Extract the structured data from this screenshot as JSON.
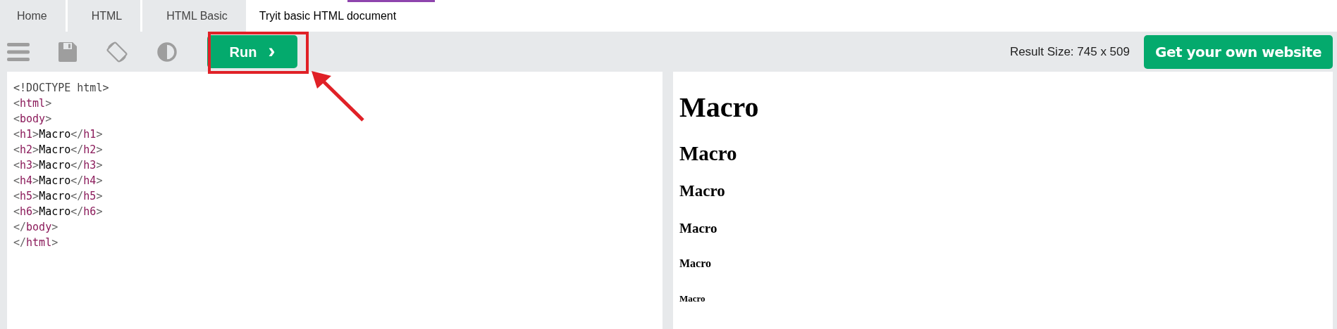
{
  "breadcrumbs": [
    {
      "label": "Home",
      "current": false
    },
    {
      "label": "HTML",
      "current": false
    },
    {
      "label": "HTML Basic",
      "current": false
    },
    {
      "label": "Tryit basic HTML document",
      "current": true
    }
  ],
  "toolbar": {
    "icons": [
      {
        "kind": "menu"
      },
      {
        "kind": "save"
      },
      {
        "kind": "rotate"
      },
      {
        "kind": "contrast"
      }
    ],
    "run_button": {
      "label": "Run",
      "icon": "›"
    },
    "result_size": "Result Size: 745 x 509",
    "cta_button": "Get your own website"
  },
  "editor": {
    "lines": [
      [
        {
          "kind": "plain",
          "text": "<!DOCTYPE html>"
        }
      ],
      [
        {
          "kind": "bracket",
          "text": "<"
        },
        {
          "kind": "tag",
          "text": "html"
        },
        {
          "kind": "bracket",
          "text": ">"
        }
      ],
      [
        {
          "kind": "bracket",
          "text": "<"
        },
        {
          "kind": "tag",
          "text": "body"
        },
        {
          "kind": "bracket",
          "text": ">"
        }
      ],
      [
        {
          "kind": "bracket",
          "text": "<"
        },
        {
          "kind": "tag",
          "text": "h1"
        },
        {
          "kind": "bracket",
          "text": ">"
        },
        {
          "kind": "text",
          "text": "Macro"
        },
        {
          "kind": "bracket",
          "text": "</"
        },
        {
          "kind": "tag",
          "text": "h1"
        },
        {
          "kind": "bracket",
          "text": ">"
        }
      ],
      [
        {
          "kind": "bracket",
          "text": "<"
        },
        {
          "kind": "tag",
          "text": "h2"
        },
        {
          "kind": "bracket",
          "text": ">"
        },
        {
          "kind": "text",
          "text": "Macro"
        },
        {
          "kind": "bracket",
          "text": "</"
        },
        {
          "kind": "tag",
          "text": "h2"
        },
        {
          "kind": "bracket",
          "text": ">"
        }
      ],
      [
        {
          "kind": "bracket",
          "text": "<"
        },
        {
          "kind": "tag",
          "text": "h3"
        },
        {
          "kind": "bracket",
          "text": ">"
        },
        {
          "kind": "text",
          "text": "Macro"
        },
        {
          "kind": "bracket",
          "text": "</"
        },
        {
          "kind": "tag",
          "text": "h3"
        },
        {
          "kind": "bracket",
          "text": ">"
        }
      ],
      [
        {
          "kind": "bracket",
          "text": "<"
        },
        {
          "kind": "tag",
          "text": "h4"
        },
        {
          "kind": "bracket",
          "text": ">"
        },
        {
          "kind": "text",
          "text": "Macro"
        },
        {
          "kind": "bracket",
          "text": "</"
        },
        {
          "kind": "tag",
          "text": "h4"
        },
        {
          "kind": "bracket",
          "text": ">"
        }
      ],
      [
        {
          "kind": "bracket",
          "text": "<"
        },
        {
          "kind": "tag",
          "text": "h5"
        },
        {
          "kind": "bracket",
          "text": ">"
        },
        {
          "kind": "text",
          "text": "Macro"
        },
        {
          "kind": "bracket",
          "text": "</"
        },
        {
          "kind": "tag",
          "text": "h5"
        },
        {
          "kind": "bracket",
          "text": ">"
        }
      ],
      [
        {
          "kind": "bracket",
          "text": "<"
        },
        {
          "kind": "tag",
          "text": "h6"
        },
        {
          "kind": "bracket",
          "text": ">"
        },
        {
          "kind": "text",
          "text": "Macro"
        },
        {
          "kind": "bracket",
          "text": "</"
        },
        {
          "kind": "tag",
          "text": "h6"
        },
        {
          "kind": "bracket",
          "text": ">"
        }
      ],
      [
        {
          "kind": "bracket",
          "text": "</"
        },
        {
          "kind": "tag",
          "text": "body"
        },
        {
          "kind": "bracket",
          "text": ">"
        }
      ],
      [
        {
          "kind": "bracket",
          "text": "</"
        },
        {
          "kind": "tag",
          "text": "html"
        },
        {
          "kind": "bracket",
          "text": ">"
        }
      ]
    ]
  },
  "result": {
    "headings": [
      {
        "text": "Macro"
      },
      {
        "text": "Macro"
      },
      {
        "text": "Macro"
      },
      {
        "text": "Macro"
      },
      {
        "text": "Macro"
      },
      {
        "text": "Macro"
      }
    ]
  }
}
